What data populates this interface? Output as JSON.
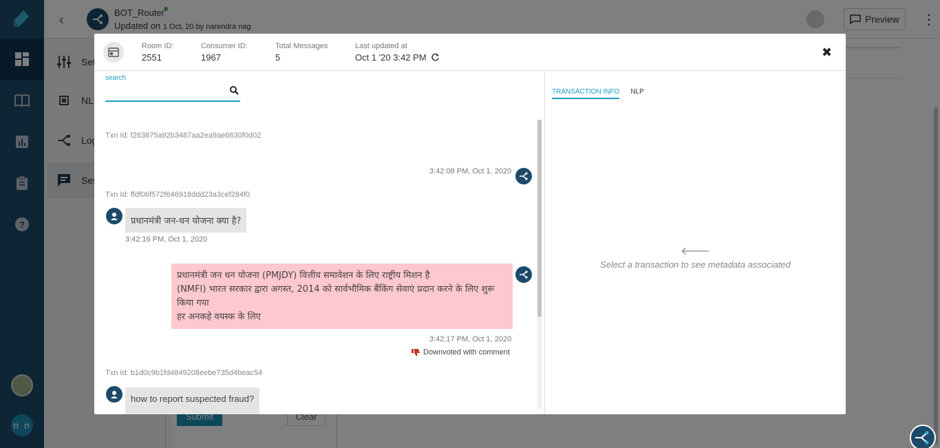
{
  "header": {
    "bot_name": "BOT_Router",
    "updated_prefix": "Updated on",
    "updated_date": "1 Oct, 20 by narendra nag",
    "preview_label": "Preview"
  },
  "subnav": {
    "items": [
      {
        "label": "Set",
        "icon": "sliders-icon"
      },
      {
        "label": "NLP",
        "icon": "chip-icon"
      },
      {
        "label": "Log",
        "icon": "flow-icon"
      },
      {
        "label": "Ses",
        "icon": "chat-icon"
      }
    ]
  },
  "background_form": {
    "submit_label": "Submit",
    "clear_label": "Clear"
  },
  "user": {
    "initials": "n n"
  },
  "modal": {
    "room_id_label": "Room ID:",
    "room_id": "2551",
    "consumer_id_label": "Consumer ID:",
    "consumer_id": "1967",
    "total_messages_label": "Total Messages",
    "total_messages": "5",
    "last_updated_label": "Last updated at",
    "last_updated": "Oct 1 '20 3:42 PM",
    "close_symbol": "✖"
  },
  "chat": {
    "search_label": "search",
    "search_value": "",
    "messages": {
      "txn1": "Txn Id: f263875a92b3487aa2ea9ae6630f0d02",
      "ts1": "3:42:08 PM, Oct 1, 2020",
      "txn2": "Txn Id: ffdf06f572f646918ddd23a3cef284f0",
      "user_msg1": "प्रधानमंत्री जन-धन योजना क्या है?",
      "ts2": "3:42:16 PM, Oct 1, 2020",
      "bot_line1": "प्रधानमंत्री जन धन योजना (PMJDY) वित्तीय समावेशन के लिए राष्ट्रीय मिशन है",
      "bot_line2": "(NMFI) भारत सरकार द्वारा अगस्त, 2014 को सार्वभौमिक बैंकिंग सेवाएं प्रदान करने के लिए शुरू",
      "bot_line3": "किया गया",
      "bot_line4": "हर अनकहे वयस्क के लिए",
      "ts3": "3:42:17 PM, Oct 1, 2020",
      "downvote_label": "Downvoted with comment",
      "txn3": "Txn Id: b1d0c9b1fd4849208eebe735d4beac54",
      "user_msg2": "how to report suspected fraud?"
    }
  },
  "info": {
    "tabs": [
      "TRANSACTION INFO",
      "NLP"
    ],
    "placeholder": "Select a transaction to see metadata associated"
  },
  "colors": {
    "nav_bg": "#1d4a6b",
    "accent": "#1a9ec4",
    "bot_bubble": "#fec8cf",
    "user_bubble": "#e4e4e4",
    "downvote": "#c0392b"
  }
}
